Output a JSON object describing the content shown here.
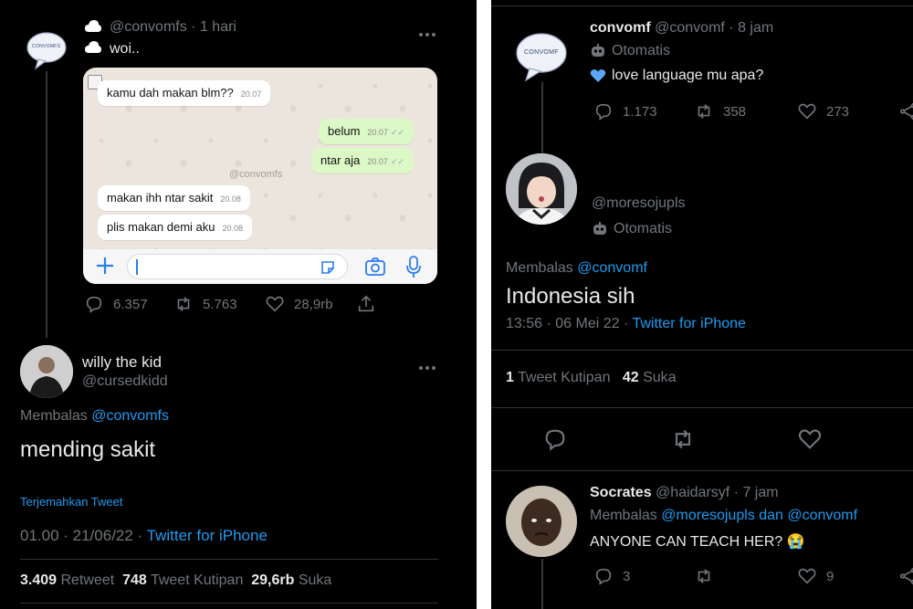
{
  "left": {
    "tweet": {
      "handle": "@convomfs",
      "time": "1 hari",
      "text": "woi..",
      "avatar_text": "CONVOMFS",
      "stats": {
        "replies": "6.357",
        "retweets": "5.763",
        "likes": "28,9rb"
      }
    },
    "chat": {
      "watermark": "@convomfs",
      "messages": [
        {
          "side": "in",
          "text": "kamu dah makan blm??",
          "time": "20.07"
        },
        {
          "side": "out",
          "text": "belum",
          "time": "20.07"
        },
        {
          "side": "out",
          "text": "ntar aja",
          "time": "20.07"
        },
        {
          "side": "in",
          "text": "makan ihh ntar sakit",
          "time": "20.08"
        },
        {
          "side": "in",
          "text": "plis makan demi aku",
          "time": "20.08"
        }
      ]
    },
    "reply": {
      "name": "willy the kid",
      "handle": "@cursedkidd",
      "replying_prefix": "Membalas",
      "replying_to": "@convomfs",
      "text": "mending sakit",
      "translate": "Terjemahkan Tweet",
      "datetime": "01.00 · 21/06/22 · ",
      "source": "Twitter for iPhone",
      "stats": {
        "retweets_value": "3.409",
        "retweets_label": "Retweet",
        "quotes_value": "748",
        "quotes_label": "Tweet Kutipan",
        "likes_value": "29,6rb",
        "likes_label": "Suka"
      }
    }
  },
  "right": {
    "tweet": {
      "name": "convomf",
      "handle": "@convomf",
      "time": "8 jam",
      "auto_label": "Otomatis",
      "text": "love language mu apa?",
      "avatar_text": "CONVOMF",
      "stats": {
        "replies": "1.173",
        "retweets": "358",
        "likes": "273"
      }
    },
    "reply": {
      "handle": "@moresojupls",
      "auto_label": "Otomatis",
      "replying_prefix": "Membalas",
      "replying_to": "@convomf",
      "text": "Indonesia sih",
      "datetime": "13:56 · 06 Mei 22 · ",
      "source": "Twitter for iPhone",
      "stats": {
        "quotes_value": "1",
        "quotes_label": "Tweet Kutipan",
        "likes_value": "42",
        "likes_label": "Suka"
      }
    },
    "reply2": {
      "name": "Socrates",
      "handle": "@haidarsyf",
      "time": "7 jam",
      "replying_prefix": "Membalas",
      "replying_to": "@moresojupls dan @convomf",
      "text": "ANYONE CAN TEACH HER? 😭",
      "stats": {
        "replies": "3",
        "likes": "9"
      }
    }
  },
  "colors": {
    "accent": "#1d9bf0",
    "background": "#000000",
    "muted": "#71767b",
    "chat_out": "#dcf8c6"
  }
}
